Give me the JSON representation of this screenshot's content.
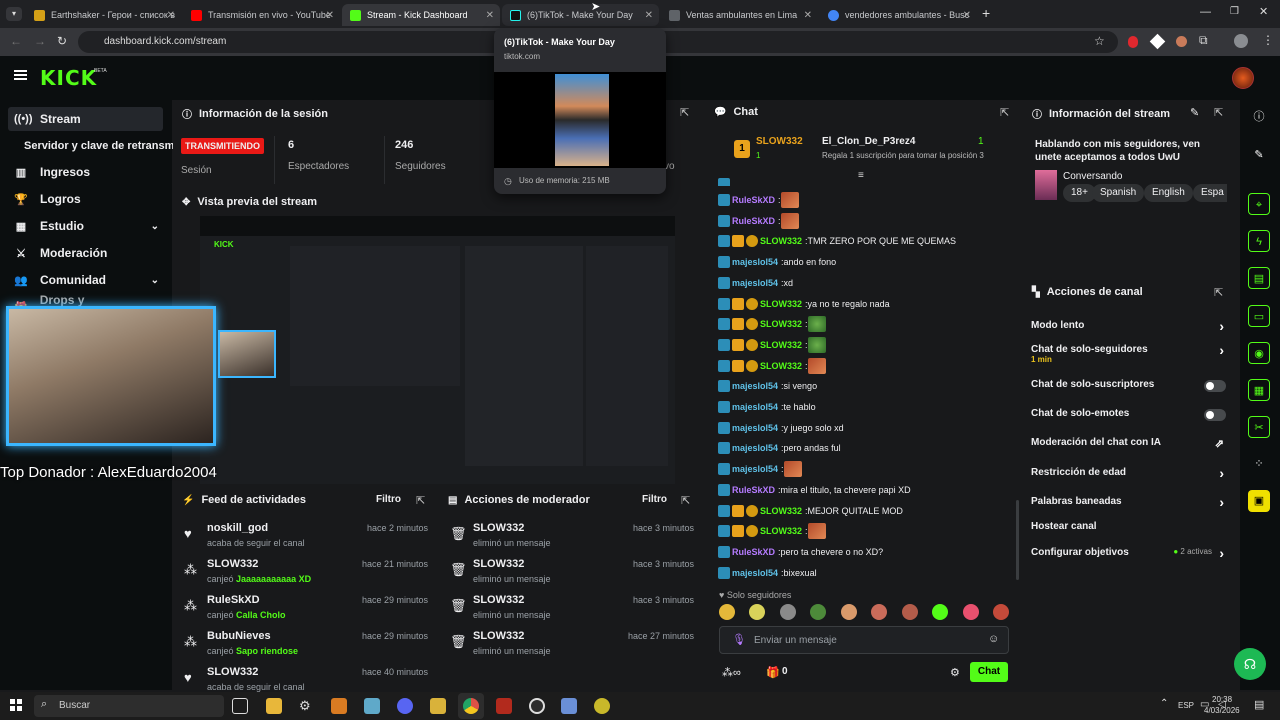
{
  "browser": {
    "tabs": [
      {
        "label": "Earthshaker - Герои - список в",
        "color": "#d4a017"
      },
      {
        "label": "Transmisión en vivo - YouTube",
        "color": "#ff0000"
      },
      {
        "label": "Stream - Kick Dashboard",
        "color": "#53fc18"
      },
      {
        "label": "(6)TikTok - Make Your Day",
        "color": "#111111"
      },
      {
        "label": "Ventas ambulantes en Lima",
        "color": "#5f6368"
      },
      {
        "label": "vendedores ambulantes - Busc",
        "color": "#4285f4"
      }
    ],
    "url": "dashboard.kick.com/stream",
    "hover_card": {
      "title": "(6)TikTok - Make Your Day",
      "domain": "tiktok.com",
      "memory": "Uso de memoria: 215 MB"
    }
  },
  "header": {
    "logo": "KICK",
    "beta": "BETA"
  },
  "sidebar": {
    "items": [
      {
        "label": "Stream",
        "icon": "broadcast-icon"
      },
      {
        "label": "Servidor y clave de retransm",
        "icon": ""
      },
      {
        "label": "Ingresos",
        "icon": "chart-icon"
      },
      {
        "label": "Logros",
        "icon": "trophy-icon"
      },
      {
        "label": "Estudio",
        "icon": "studio-icon"
      },
      {
        "label": "Moderación",
        "icon": "sword-icon"
      },
      {
        "label": "Comunidad",
        "icon": "community-icon"
      },
      {
        "label": "Drops y recompensas",
        "icon": "gift-icon"
      }
    ]
  },
  "session": {
    "title": "Información de la sesión",
    "status": "TRANSMITIENDO",
    "status_label": "Sesión",
    "viewers": "6",
    "viewers_label": "Espectadores",
    "followers": "246",
    "followers_label": "Seguidores",
    "extra_label": "vo"
  },
  "preview": {
    "title": "Vista previa del stream",
    "overlay_text": "Top Donador : AlexEduardo2004"
  },
  "activity": {
    "title": "Feed de actividades",
    "filter": "Filtro",
    "rows": [
      {
        "name": "noskill_god",
        "sub": "acaba de seguir el canal",
        "hl": "",
        "time": "hace 2 minutos",
        "icon": "heart-icon"
      },
      {
        "name": "SLOW332",
        "sub": "canjeó ",
        "hl": "Jaaaaaaaaaaa XD",
        "time": "hace 21 minutos",
        "icon": "reward-icon"
      },
      {
        "name": "RuleSkXD",
        "sub": "canjeó ",
        "hl": "Calla Cholo",
        "time": "hace 29 minutos",
        "icon": "reward-icon"
      },
      {
        "name": "BubuNieves",
        "sub": "canjeó ",
        "hl": "Sapo riendose",
        "time": "hace 29 minutos",
        "icon": "reward-icon"
      },
      {
        "name": "SLOW332",
        "sub": "acaba de seguir el canal",
        "hl": "",
        "time": "hace 40 minutos",
        "icon": "heart-icon"
      }
    ]
  },
  "modactions": {
    "title": "Acciones de moderador",
    "filter": "Filtro",
    "rows": [
      {
        "name": "SLOW332",
        "sub": "eliminó un mensaje",
        "time": "hace 3 minutos"
      },
      {
        "name": "SLOW332",
        "sub": "eliminó un mensaje",
        "time": "hace 3 minutos"
      },
      {
        "name": "SLOW332",
        "sub": "eliminó un mensaje",
        "time": "hace 3 minutos"
      },
      {
        "name": "SLOW332",
        "sub": "eliminó un mensaje",
        "time": "hace 27 minutos"
      }
    ]
  },
  "chat": {
    "title": "Chat",
    "top_user": "SLOW332",
    "top_count": "1",
    "gifter": "El_Clon_De_P3rez4",
    "gifter_count": "1",
    "gift_msg": "Regala 1 suscripción para tomar la posición 3",
    "messages": [
      {
        "user": "RuleSkXD",
        "text": "",
        "color": "#b57bff",
        "badges": "k",
        "emote": true
      },
      {
        "user": "RuleSkXD",
        "text": "",
        "color": "#b57bff",
        "badges": "k",
        "emote": true
      },
      {
        "user": "SLOW332",
        "text": "TMR ZERO POR QUE ME QUEMAS",
        "color": "#53fc18",
        "badges": "kcs",
        "emote": false
      },
      {
        "user": "majeslol54",
        "text": "ando en fono",
        "color": "#5fc1e8",
        "badges": "k",
        "emote": false
      },
      {
        "user": "majeslol54",
        "text": "xd",
        "color": "#5fc1e8",
        "badges": "k",
        "emote": false
      },
      {
        "user": "SLOW332",
        "text": "ya no te regalo nada",
        "color": "#53fc18",
        "badges": "kcs",
        "emote": false
      },
      {
        "user": "SLOW332",
        "text": "",
        "color": "#53fc18",
        "badges": "kcs",
        "emote": "g"
      },
      {
        "user": "SLOW332",
        "text": "",
        "color": "#53fc18",
        "badges": "kcs",
        "emote": "g"
      },
      {
        "user": "SLOW332",
        "text": "",
        "color": "#53fc18",
        "badges": "kcs",
        "emote": true
      },
      {
        "user": "majeslol54",
        "text": "si vengo",
        "color": "#5fc1e8",
        "badges": "k",
        "emote": false
      },
      {
        "user": "majeslol54",
        "text": "te hablo",
        "color": "#5fc1e8",
        "badges": "k",
        "emote": false
      },
      {
        "user": "majeslol54",
        "text": "y juego solo xd",
        "color": "#5fc1e8",
        "badges": "k",
        "emote": false
      },
      {
        "user": "majeslol54",
        "text": "pero andas ful",
        "color": "#5fc1e8",
        "badges": "k",
        "emote": false
      },
      {
        "user": "majeslol54",
        "text": "",
        "color": "#5fc1e8",
        "badges": "k",
        "emote": true
      },
      {
        "user": "RuleSkXD",
        "text": "mira el titulo, ta chevere papi XD",
        "color": "#b57bff",
        "badges": "k",
        "emote": false
      },
      {
        "user": "SLOW332",
        "text": "MEJOR QUITALE MOD",
        "color": "#53fc18",
        "badges": "kcs",
        "emote": false
      },
      {
        "user": "SLOW332",
        "text": "",
        "color": "#53fc18",
        "badges": "kcs",
        "emote": true
      },
      {
        "user": "RuleSkXD",
        "text": "pero ta chevere o no XD?",
        "color": "#b57bff",
        "badges": "k",
        "emote": false
      },
      {
        "user": "majeslol54",
        "text": "bixexual",
        "color": "#5fc1e8",
        "badges": "k",
        "emote": false
      }
    ],
    "followers_only": "Solo seguidores",
    "input_placeholder": "Enviar un mensaje",
    "points": "0",
    "send": "Chat"
  },
  "stream_info": {
    "title": "Información del stream",
    "description": "Hablando con mis seguidores, ven unete aceptamos a todos UwU",
    "category": "Conversando",
    "tags": [
      "18+",
      "Spanish",
      "English",
      "Espa"
    ]
  },
  "channel_actions": {
    "title": "Acciones de canal",
    "rows": [
      {
        "label": "Modo lento",
        "type": "chev",
        "sub": ""
      },
      {
        "label": "Chat de solo-seguidores",
        "type": "chev",
        "sub": "1 min"
      },
      {
        "label": "Chat de solo-suscriptores",
        "type": "toggle",
        "sub": ""
      },
      {
        "label": "Chat de solo-emotes",
        "type": "toggle",
        "sub": ""
      },
      {
        "label": "Moderación del chat con IA",
        "type": "ext",
        "sub": ""
      },
      {
        "label": "Restricción de edad",
        "type": "chev",
        "sub": ""
      },
      {
        "label": "Palabras baneadas",
        "type": "chev",
        "sub": ""
      },
      {
        "label": "Hostear canal",
        "type": "none",
        "sub": ""
      },
      {
        "label": "Configurar objetivos",
        "type": "chev",
        "sub": "2 activas"
      }
    ]
  },
  "taskbar": {
    "search": "Buscar",
    "lang": "ESP",
    "time": "20:38",
    "date": "4/03/2026"
  },
  "colors": {
    "accent": "#53fc18",
    "live": "#e91916",
    "bg": "#18191b"
  }
}
